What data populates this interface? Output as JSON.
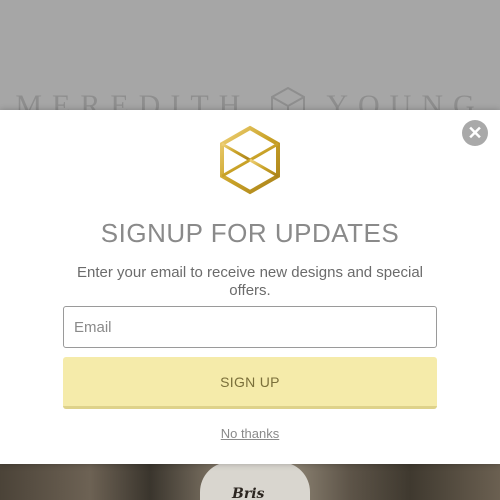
{
  "background": {
    "brand_left": "MEREDITH",
    "brand_right": "YOUNG",
    "photo_label": "Bris"
  },
  "modal": {
    "title": "SIGNUP FOR UPDATES",
    "subtitle": "Enter your email to receive new designs and special offers.",
    "email_placeholder": "Email",
    "email_value": "",
    "signup_label": "SIGN UP",
    "dismiss_label": "No thanks",
    "close_glyph": "✕"
  },
  "icons": {
    "close": "close-icon",
    "logo": "hexagon-cube-logo"
  },
  "colors": {
    "overlay": "#a6a6a6",
    "accent_gold": "#c9a227",
    "button_bg": "#f5ebaa",
    "title_gray": "#8a8a8a"
  }
}
